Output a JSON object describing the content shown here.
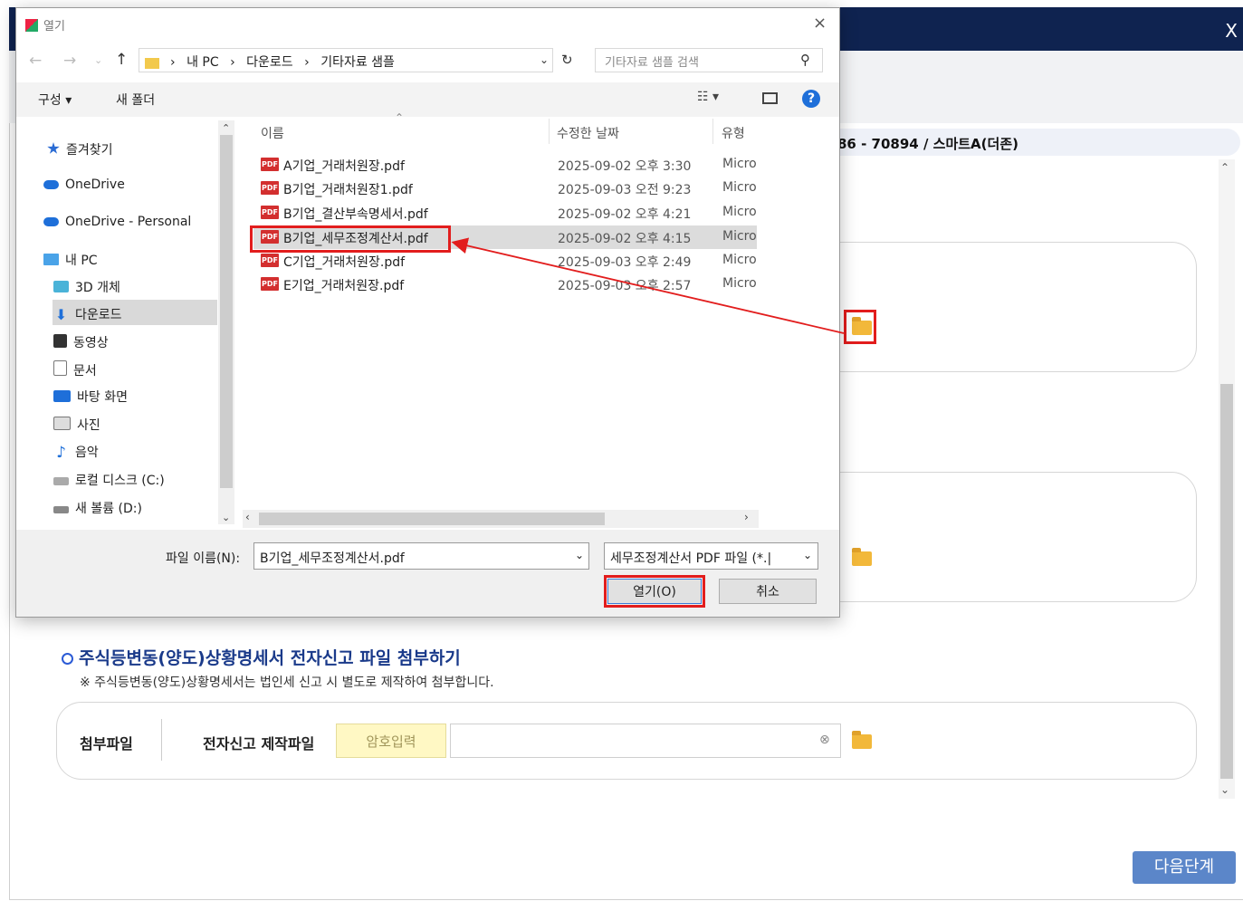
{
  "app": {
    "close_label": "X",
    "company_info": "86 - 70894 / 스마트A(더존)",
    "section_title": "주식등변동(양도)상황명세서 전자신고 파일 첨부하기",
    "section_note": "※ 주식등변동(양도)상황명세서는 법인세 신고 시 별도로 제작하여 첨부합니다.",
    "attach_label": "첨부파일",
    "efile_label": "전자신고 제작파일",
    "password_placeholder": "암호입력",
    "next_button": "다음단계"
  },
  "dialog": {
    "title": "열기",
    "close_label": "×",
    "breadcrumb": [
      "내 PC",
      "다운로드",
      "기타자료 샘플"
    ],
    "search_placeholder": "기타자료 샘플 검색",
    "toolbar": {
      "organize": "구성 ▾",
      "new_folder": "새 폴더",
      "view": "☷ ▾",
      "help": "?"
    },
    "nav_items": [
      {
        "label": "즐겨찾기",
        "icon": "star-icon"
      },
      {
        "label": "OneDrive",
        "icon": "cloud-icon"
      },
      {
        "label": "OneDrive - Personal",
        "icon": "cloud-icon"
      },
      {
        "label": "내 PC",
        "icon": "computer-icon"
      },
      {
        "label": "3D 개체",
        "icon": "cube-icon"
      },
      {
        "label": "다운로드",
        "icon": "download-icon"
      },
      {
        "label": "동영상",
        "icon": "film-icon"
      },
      {
        "label": "문서",
        "icon": "document-icon"
      },
      {
        "label": "바탕 화면",
        "icon": "desktop-icon"
      },
      {
        "label": "사진",
        "icon": "picture-icon"
      },
      {
        "label": "음악",
        "icon": "music-icon"
      },
      {
        "label": "로컬 디스크 (C:)",
        "icon": "disk-icon"
      },
      {
        "label": "새 볼륨 (D:)",
        "icon": "disk-icon"
      }
    ],
    "columns": {
      "name": "이름",
      "date": "수정한 날짜",
      "type": "유형"
    },
    "files": [
      {
        "name": "A기업_거래처원장.pdf",
        "date": "2025-09-02 오후 3:30",
        "type": "Micro"
      },
      {
        "name": "B기업_거래처원장1.pdf",
        "date": "2025-09-03 오전 9:23",
        "type": "Micro"
      },
      {
        "name": "B기업_결산부속명세서.pdf",
        "date": "2025-09-02 오후 4:21",
        "type": "Micro"
      },
      {
        "name": "B기업_세무조정계산서.pdf",
        "date": "2025-09-02 오후 4:15",
        "type": "Micro"
      },
      {
        "name": "C기업_거래처원장.pdf",
        "date": "2025-09-03 오후 2:49",
        "type": "Micro"
      },
      {
        "name": "E기업_거래처원장.pdf",
        "date": "2025-09-03 오후 2:57",
        "type": "Micro"
      }
    ],
    "pdf_badge": "PDF",
    "filename_label": "파일 이름(N):",
    "filename_value": "B기업_세무조정계산서.pdf",
    "filetype_value": "세무조정계산서 PDF 파일 (*.|",
    "open_button": "열기(O)",
    "cancel_button": "취소"
  },
  "colors": {
    "header": "#0f2350",
    "highlight": "#e21d1d",
    "accent_blue": "#1e6fd9",
    "next_button": "#5b86c9"
  }
}
